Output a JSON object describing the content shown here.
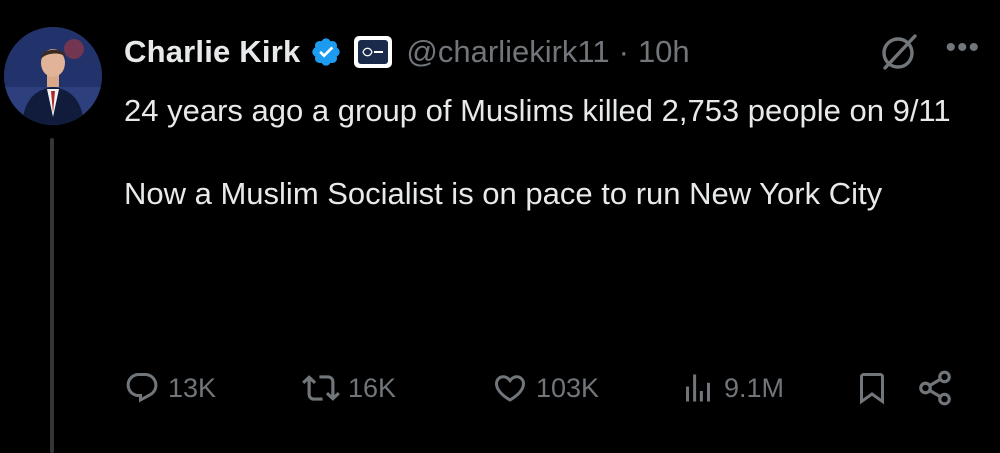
{
  "tweet": {
    "author_name": "Charlie Kirk",
    "handle": "@charliekirk11",
    "separator": "·",
    "time": "10h",
    "more_label": "•••",
    "paragraphs": [
      "24 years ago a group of Muslims killed 2,753 people on 9/11",
      "Now a Muslim Socialist is on pace to run New York City"
    ]
  },
  "actions": {
    "replies": "13K",
    "reposts": "16K",
    "likes": "103K",
    "views": "9.1M"
  },
  "icons": {
    "avatar": "avatar-photo",
    "verified": "verified-badge-icon",
    "affiliate": "affiliate-badge-icon",
    "grok": "grok-icon",
    "more": "more-icon",
    "reply": "reply-icon",
    "repost": "repost-icon",
    "like": "heart-icon",
    "views": "views-icon",
    "bookmark": "bookmark-icon",
    "share": "share-icon"
  },
  "colors": {
    "background": "#000000",
    "text": "#e7e9ea",
    "muted": "#71767b",
    "verified": "#1d9bf0"
  }
}
